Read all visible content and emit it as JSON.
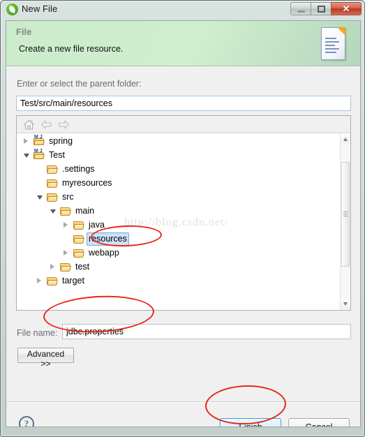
{
  "window": {
    "title": "New File",
    "icon": "spring-leaf-icon",
    "controls": {
      "minimize": "–",
      "maximize": "□",
      "close": "✕"
    }
  },
  "banner": {
    "title": "File",
    "subtitle": "Create a new file resource.",
    "icon": "new-file-document-icon"
  },
  "parent_folder": {
    "label": "Enter or select the parent folder:",
    "value": "Test/src/main/resources",
    "placeholder": ""
  },
  "tree_toolbar": {
    "home": "home-icon",
    "back": "back-arrow-icon",
    "forward": "forward-arrow-icon"
  },
  "tree": {
    "nodes": [
      {
        "label": "spring",
        "indent": 0,
        "twisty": "collapsed",
        "icon": "maven-project-icon",
        "selected": false
      },
      {
        "label": "Test",
        "indent": 0,
        "twisty": "expanded",
        "icon": "maven-project-icon",
        "selected": false
      },
      {
        "label": ".settings",
        "indent": 1,
        "twisty": "none",
        "icon": "folder-icon",
        "selected": false
      },
      {
        "label": "myresources",
        "indent": 1,
        "twisty": "none",
        "icon": "folder-icon",
        "selected": false
      },
      {
        "label": "src",
        "indent": 1,
        "twisty": "expanded",
        "icon": "folder-icon",
        "selected": false
      },
      {
        "label": "main",
        "indent": 2,
        "twisty": "expanded",
        "icon": "folder-icon",
        "selected": false
      },
      {
        "label": "java",
        "indent": 3,
        "twisty": "collapsed",
        "icon": "folder-icon",
        "selected": false
      },
      {
        "label": "resources",
        "indent": 3,
        "twisty": "none",
        "icon": "folder-icon",
        "selected": true
      },
      {
        "label": "webapp",
        "indent": 3,
        "twisty": "collapsed",
        "icon": "folder-icon",
        "selected": false
      },
      {
        "label": "test",
        "indent": 2,
        "twisty": "collapsed",
        "icon": "folder-icon",
        "selected": false
      },
      {
        "label": "target",
        "indent": 1,
        "twisty": "collapsed",
        "icon": "folder-icon",
        "selected": false
      }
    ]
  },
  "watermark": {
    "text": "http://blog.csdn.net/"
  },
  "file_name": {
    "label": "File name:",
    "value": "jdbc.properties",
    "placeholder": ""
  },
  "buttons": {
    "advanced": "Advanced >>",
    "finish": "Finish",
    "cancel": "Cancel",
    "help": "?"
  },
  "colors": {
    "banner_green": "#cbeccb",
    "selection_blue": "#cde2f7",
    "finish_border": "#2d9cdb",
    "annotation_red": "#e8261c",
    "close_button_red": "#b83a22"
  },
  "annotations": [
    {
      "name": "resources-highlight",
      "shape": "ellipse",
      "target": "resources"
    },
    {
      "name": "filename-highlight",
      "shape": "ellipse",
      "target": "jdbc.properties"
    },
    {
      "name": "finish-highlight",
      "shape": "ellipse",
      "target": "Finish"
    }
  ]
}
